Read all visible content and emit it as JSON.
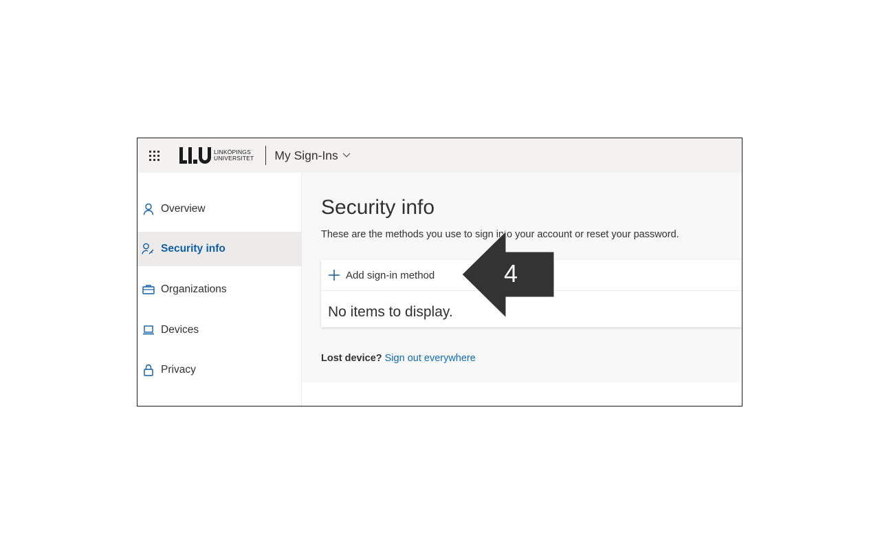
{
  "header": {
    "logo_line1": "LINKÖPINGS",
    "logo_line2": "UNIVERSITET",
    "app_title": "My Sign-Ins"
  },
  "sidebar": {
    "items": [
      {
        "label": "Overview",
        "icon": "person-icon",
        "active": false
      },
      {
        "label": "Security info",
        "icon": "person-key-icon",
        "active": true
      },
      {
        "label": "Organizations",
        "icon": "briefcase-icon",
        "active": false
      },
      {
        "label": "Devices",
        "icon": "laptop-icon",
        "active": false
      },
      {
        "label": "Privacy",
        "icon": "lock-icon",
        "active": false
      }
    ]
  },
  "main": {
    "title": "Security info",
    "subtitle": "These are the methods you use to sign into your account or reset your password.",
    "add_method_label": "Add sign-in method",
    "empty_message": "No items to display.",
    "lost_device_label": "Lost device?",
    "sign_out_link": "Sign out everywhere"
  },
  "annotation": {
    "step_number": "4"
  },
  "colors": {
    "accent": "#0f5ea8",
    "link": "#0f6cbd",
    "arrow": "#333333"
  }
}
